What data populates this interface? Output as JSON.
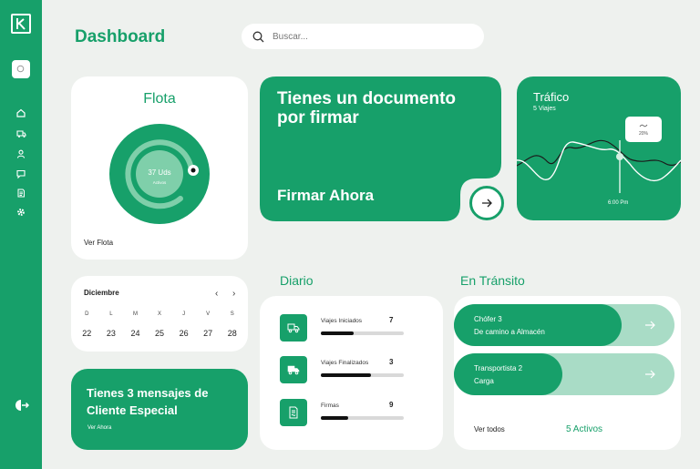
{
  "app": {
    "logo_letter": "k"
  },
  "header": {
    "title": "Dashboard",
    "search_placeholder": "Buscar..."
  },
  "sidebar": {
    "items": [
      {
        "icon": "home-icon"
      },
      {
        "icon": "truck-icon"
      },
      {
        "icon": "user-icon"
      },
      {
        "icon": "chat-icon"
      },
      {
        "icon": "document-icon"
      },
      {
        "icon": "gear-icon"
      }
    ]
  },
  "flota": {
    "title": "Flota",
    "units": "37 Uds",
    "sublabel": "Activos",
    "link": "Ver Flota"
  },
  "documento": {
    "line1": "Tienes un documento por firmar",
    "action": "Firmar Ahora"
  },
  "trafico": {
    "title": "Tráfico",
    "subtitle": "5 Viajes",
    "tooltip": "20%",
    "time": "6:00 Pm"
  },
  "calendario": {
    "month": "Diciembre",
    "prev": "‹",
    "next": "›",
    "weekdays": [
      "D",
      "L",
      "M",
      "X",
      "J",
      "V",
      "S"
    ],
    "dates": [
      "22",
      "23",
      "24",
      "25",
      "26",
      "27",
      "28"
    ]
  },
  "mensajes": {
    "text": "Tienes 3 mensajes de Cliente Especial",
    "link": "Ver Ahora"
  },
  "diario": {
    "title": "Diario",
    "rows": [
      {
        "label": "Viajes Iniciados",
        "value": "7",
        "progress": 0.4,
        "icon": "truck-icon"
      },
      {
        "label": "Viajes Finalizados",
        "value": "3",
        "progress": 0.6,
        "icon": "delivery-truck-icon"
      },
      {
        "label": "Firmas",
        "value": "9",
        "progress": 0.33,
        "icon": "signature-document-icon"
      }
    ]
  },
  "transito": {
    "title": "En Tránsito",
    "items": [
      {
        "name": "Chófer 3",
        "status": "De camino a Almacén",
        "progress": 0.76
      },
      {
        "name": "Transportista 2",
        "status": "Carga",
        "progress": 0.49
      }
    ],
    "see_all": "Ver todos",
    "active": "5 Activos"
  },
  "colors": {
    "accent": "#17a06a",
    "accent_light": "#a9dcc6",
    "background": "#eef1ee"
  }
}
